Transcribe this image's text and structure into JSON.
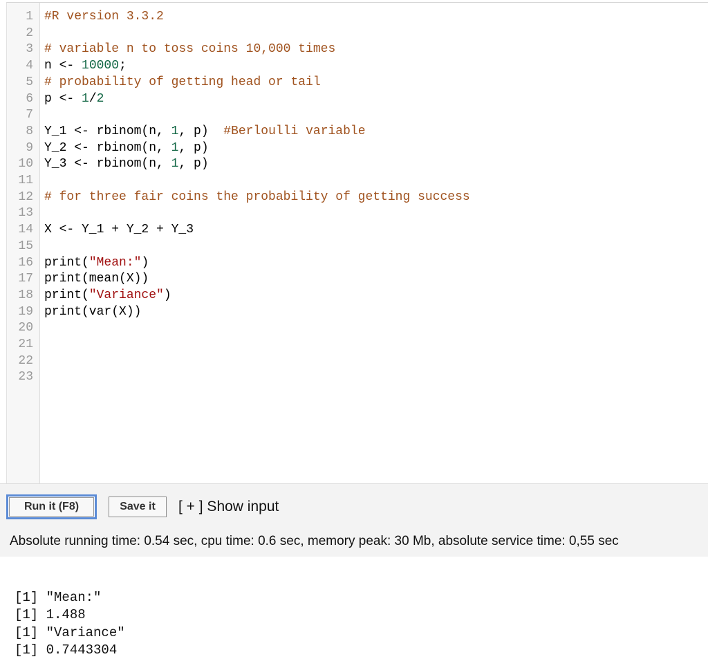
{
  "editor": {
    "lines": [
      {
        "n": "1",
        "segments": [
          {
            "t": "#R version 3.3.2",
            "c": "cm"
          }
        ]
      },
      {
        "n": "2",
        "segments": []
      },
      {
        "n": "3",
        "segments": [
          {
            "t": "# variable n to toss coins 10,000 times",
            "c": "cm"
          }
        ]
      },
      {
        "n": "4",
        "segments": [
          {
            "t": "n <- ",
            "c": ""
          },
          {
            "t": "10000",
            "c": "num"
          },
          {
            "t": ";",
            "c": ""
          }
        ]
      },
      {
        "n": "5",
        "segments": [
          {
            "t": "# probability of getting head or tail",
            "c": "cm"
          }
        ]
      },
      {
        "n": "6",
        "segments": [
          {
            "t": "p <- ",
            "c": ""
          },
          {
            "t": "1",
            "c": "num"
          },
          {
            "t": "/",
            "c": ""
          },
          {
            "t": "2",
            "c": "num"
          }
        ]
      },
      {
        "n": "7",
        "segments": []
      },
      {
        "n": "8",
        "segments": [
          {
            "t": "Y_1 <- rbinom(n, ",
            "c": ""
          },
          {
            "t": "1",
            "c": "num"
          },
          {
            "t": ", p)  ",
            "c": ""
          },
          {
            "t": "#Berloulli variable",
            "c": "cm"
          }
        ]
      },
      {
        "n": "9",
        "segments": [
          {
            "t": "Y_2 <- rbinom(n, ",
            "c": ""
          },
          {
            "t": "1",
            "c": "num"
          },
          {
            "t": ", p)",
            "c": ""
          }
        ]
      },
      {
        "n": "10",
        "segments": [
          {
            "t": "Y_3 <- rbinom(n, ",
            "c": ""
          },
          {
            "t": "1",
            "c": "num"
          },
          {
            "t": ", p)",
            "c": ""
          }
        ]
      },
      {
        "n": "11",
        "segments": []
      },
      {
        "n": "12",
        "segments": [
          {
            "t": "# for three fair coins the probability of getting success",
            "c": "cm"
          }
        ]
      },
      {
        "n": "13",
        "segments": []
      },
      {
        "n": "14",
        "segments": [
          {
            "t": "X <- Y_1 + Y_2 + Y_3",
            "c": ""
          }
        ]
      },
      {
        "n": "15",
        "segments": []
      },
      {
        "n": "16",
        "segments": [
          {
            "t": "print(",
            "c": ""
          },
          {
            "t": "\"Mean:\"",
            "c": "str"
          },
          {
            "t": ")",
            "c": ""
          }
        ]
      },
      {
        "n": "17",
        "segments": [
          {
            "t": "print(mean(X))",
            "c": ""
          }
        ]
      },
      {
        "n": "18",
        "segments": [
          {
            "t": "print(",
            "c": ""
          },
          {
            "t": "\"Variance\"",
            "c": "str"
          },
          {
            "t": ")",
            "c": ""
          }
        ]
      },
      {
        "n": "19",
        "segments": [
          {
            "t": "print(var(X))",
            "c": ""
          }
        ]
      },
      {
        "n": "20",
        "segments": []
      },
      {
        "n": "21",
        "segments": []
      },
      {
        "n": "22",
        "segments": []
      },
      {
        "n": "23",
        "segments": []
      }
    ]
  },
  "toolbar": {
    "run_label": "Run it (F8)",
    "save_label": "Save it",
    "show_input_label": "[ + ] Show input"
  },
  "stats": "Absolute running time: 0.54 sec, cpu time: 0.6 sec, memory peak: 30 Mb, absolute service time: 0,55 sec",
  "output": [
    "[1] \"Mean:\"",
    "[1] 1.488",
    "[1] \"Variance\"",
    "[1] 0.7443304"
  ],
  "colors": {
    "comment": "#a0521e",
    "number": "#116644",
    "string": "#a11111",
    "run_focus": "#5b8bd6"
  }
}
